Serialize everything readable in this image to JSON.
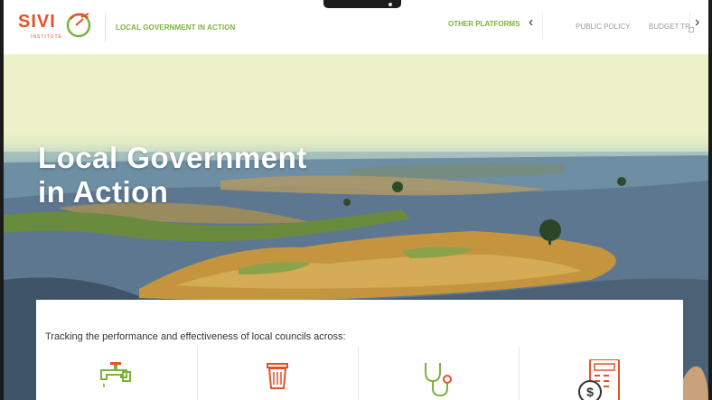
{
  "header": {
    "logo_text": "SIVI",
    "logo_sub": "INSTITUTE",
    "site_title": "LOCAL GOVERNMENT IN ACTION",
    "platforms_label": "OTHER PLATFORMS",
    "platform_items": [
      "PUBLIC POLICY",
      "BUDGET TRACKER"
    ]
  },
  "hero": {
    "title_line1": "Local Government",
    "title_line2": "in Action"
  },
  "card": {
    "text": "Tracking the performance and effectiveness of local councils across:",
    "tiles": [
      {
        "icon": "water-tap-icon"
      },
      {
        "icon": "trash-bin-icon"
      },
      {
        "icon": "stethoscope-icon"
      },
      {
        "icon": "calculator-dollar-icon"
      }
    ]
  },
  "colors": {
    "brand_orange": "#e2522a",
    "brand_green": "#7bb33a"
  }
}
